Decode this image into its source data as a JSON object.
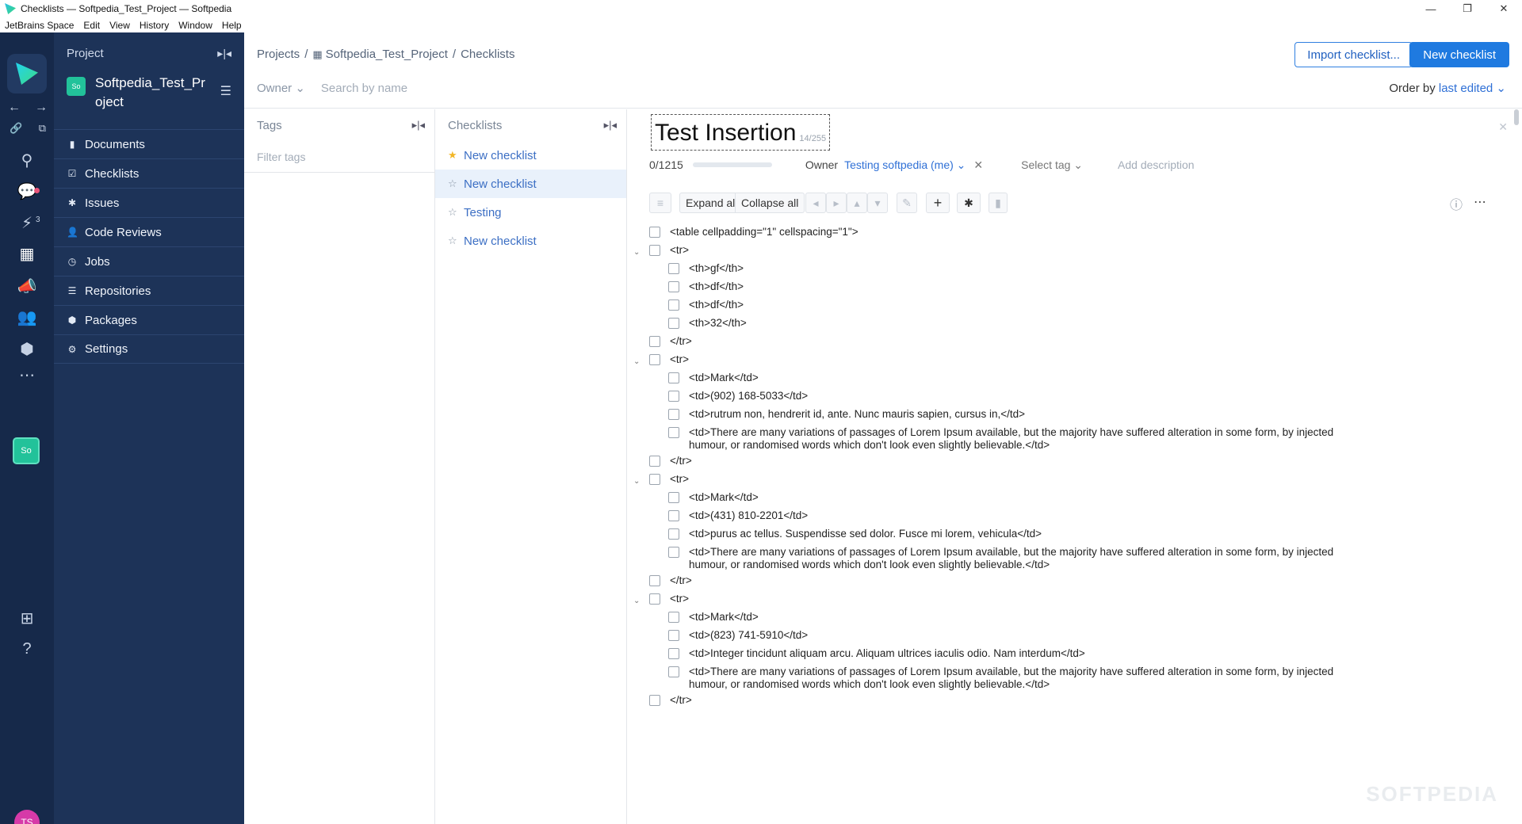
{
  "window": {
    "title": "Checklists — Softpedia_Test_Project — Softpedia",
    "controls": {
      "minimize": "—",
      "restore": "❐",
      "close": "✕"
    }
  },
  "menu": [
    "JetBrains Space",
    "Edit",
    "View",
    "History",
    "Window",
    "Help"
  ],
  "rail": {
    "badge_count": "3",
    "project_initials": "So",
    "avatar_initials": "TS"
  },
  "project_sidebar": {
    "header": "Project",
    "project_initials": "So",
    "project_name": "Softpedia_Test_Project",
    "items": [
      {
        "label": "Documents",
        "icon": "document-icon",
        "glyph": "▮"
      },
      {
        "label": "Checklists",
        "icon": "checklist-icon",
        "glyph": "☑"
      },
      {
        "label": "Issues",
        "icon": "bug-icon",
        "glyph": "✱"
      },
      {
        "label": "Code Reviews",
        "icon": "code-review-icon",
        "glyph": "👤"
      },
      {
        "label": "Jobs",
        "icon": "jobs-icon",
        "glyph": "◷"
      },
      {
        "label": "Repositories",
        "icon": "repositories-icon",
        "glyph": "☰"
      },
      {
        "label": "Packages",
        "icon": "packages-icon",
        "glyph": "⬢"
      },
      {
        "label": "Settings",
        "icon": "settings-icon",
        "glyph": "⚙"
      }
    ]
  },
  "topbar": {
    "crumbs": {
      "projects": "Projects",
      "sep": "/",
      "project": "Softpedia_Test_Project",
      "page": "Checklists"
    },
    "import_button": "Import checklist...",
    "new_button": "New checklist",
    "owner_filter": "Owner ⌄",
    "search_placeholder": "Search by name",
    "order_label": "Order by",
    "order_value": "last edited ⌄"
  },
  "tags": {
    "header": "Tags",
    "filter_placeholder": "Filter tags"
  },
  "checklists": {
    "header": "Checklists",
    "items": [
      {
        "label": "New checklist",
        "starred": true
      },
      {
        "label": "New checklist",
        "starred": false,
        "selected": true
      },
      {
        "label": "Testing",
        "starred": false
      },
      {
        "label": "New checklist",
        "starred": false
      }
    ]
  },
  "editor": {
    "title": "Test Insertion",
    "title_count": "14/255",
    "progress": "0/1215",
    "progress_fraction": 0.0,
    "owner_label": "Owner",
    "owner_value": "Testing softpedia (me) ⌄",
    "select_tag": "Select tag ⌄",
    "add_description": "Add description",
    "expand_all": "Expand all",
    "collapse_all": "Collapse all",
    "items": [
      {
        "level": 0,
        "text": "<table cellpadding=\"1\" cellspacing=\"1\">"
      },
      {
        "level": 0,
        "text": "<tr>",
        "expanded": true
      },
      {
        "level": 1,
        "text": "<th>gf</th>"
      },
      {
        "level": 1,
        "text": "<th>df</th>"
      },
      {
        "level": 1,
        "text": "<th>df</th>"
      },
      {
        "level": 1,
        "text": "<th>32</th>"
      },
      {
        "level": 0,
        "text": "</tr>"
      },
      {
        "level": 0,
        "text": "<tr>",
        "expanded": true
      },
      {
        "level": 1,
        "text": "<td>Mark</td>"
      },
      {
        "level": 1,
        "text": "<td>(902) 168-5033</td>"
      },
      {
        "level": 1,
        "text": "<td>rutrum non, hendrerit id, ante. Nunc mauris sapien, cursus in,</td>"
      },
      {
        "level": 1,
        "text": "<td>There are many variations of passages of Lorem Ipsum available, but the majority have suffered alteration in some form, by injected humour, or randomised words which don't look even slightly believable.</td>"
      },
      {
        "level": 0,
        "text": "</tr>"
      },
      {
        "level": 0,
        "text": "<tr>",
        "expanded": true
      },
      {
        "level": 1,
        "text": "<td>Mark</td>"
      },
      {
        "level": 1,
        "text": "<td>(431) 810-2201</td>"
      },
      {
        "level": 1,
        "text": "<td>purus ac tellus. Suspendisse sed dolor. Fusce mi lorem, vehicula</td>"
      },
      {
        "level": 1,
        "text": "<td>There are many variations of passages of Lorem Ipsum available, but the majority have suffered alteration in some form, by injected humour, or randomised words which don't look even slightly believable.</td>"
      },
      {
        "level": 0,
        "text": "</tr>"
      },
      {
        "level": 0,
        "text": "<tr>",
        "expanded": true
      },
      {
        "level": 1,
        "text": "<td>Mark</td>"
      },
      {
        "level": 1,
        "text": "<td>(823) 741-5910</td>"
      },
      {
        "level": 1,
        "text": "<td>Integer tincidunt aliquam arcu. Aliquam ultrices iaculis odio. Nam interdum</td>"
      },
      {
        "level": 1,
        "text": "<td>There are many variations of passages of Lorem Ipsum available, but the majority have suffered alteration in some form, by injected humour, or randomised words which don't look even slightly believable.</td>"
      },
      {
        "level": 0,
        "text": "</tr>"
      }
    ]
  },
  "watermark": "SOFTPEDIA"
}
